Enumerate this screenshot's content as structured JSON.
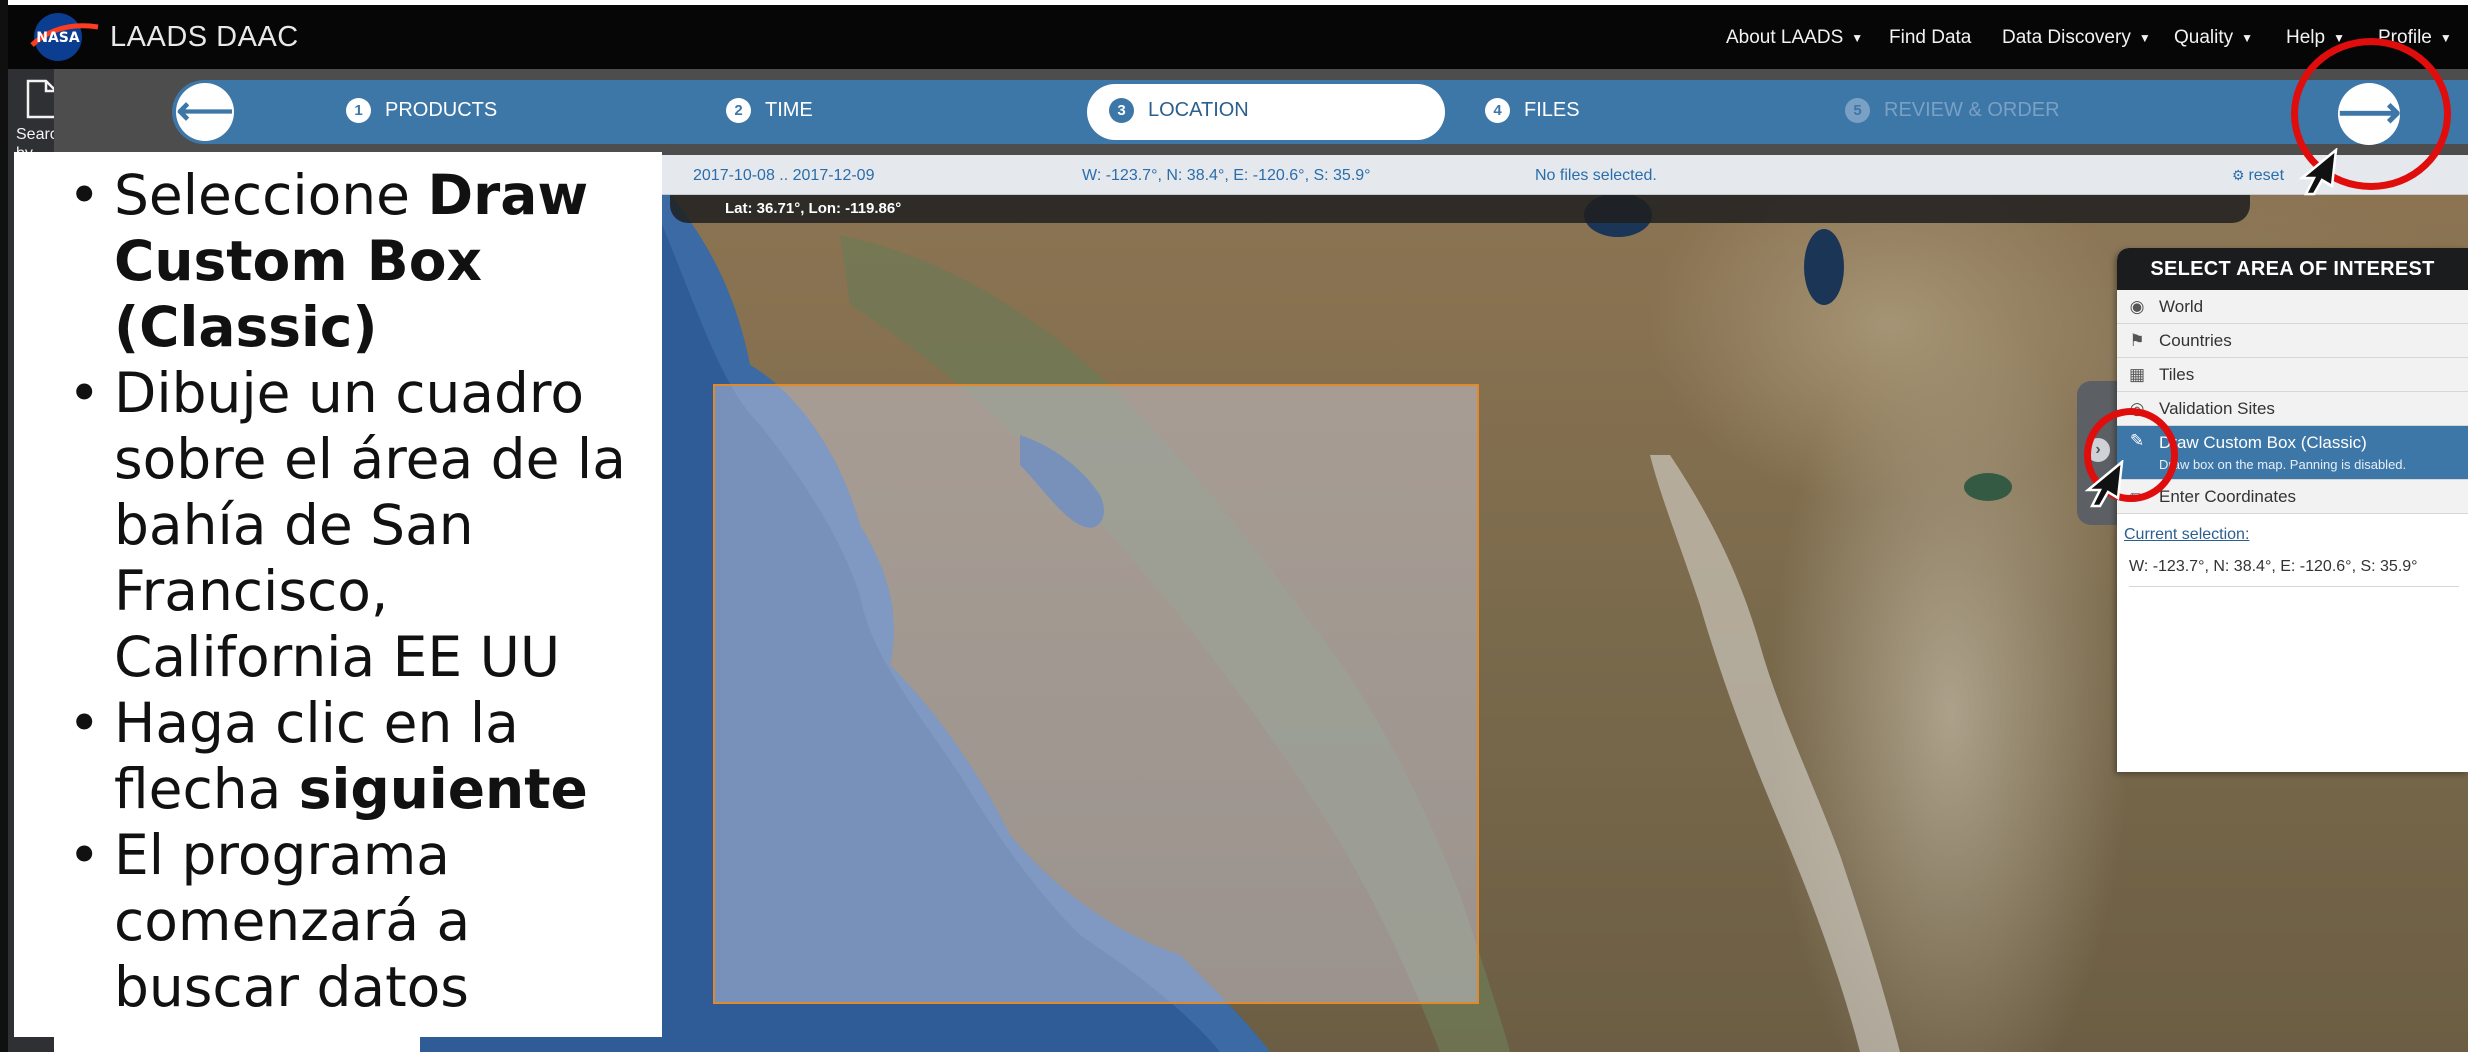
{
  "header": {
    "logo_text": "NASA",
    "app_title": "LAADS DAAC",
    "nav": [
      {
        "label": "About LAADS",
        "dropdown": true
      },
      {
        "label": "Find Data",
        "dropdown": false
      },
      {
        "label": "Data Discovery",
        "dropdown": true
      },
      {
        "label": "Quality",
        "dropdown": true
      },
      {
        "label": "Help",
        "dropdown": true
      },
      {
        "label": "Profile",
        "dropdown": true
      }
    ]
  },
  "sidebar": {
    "search_label": "Search by Product"
  },
  "steps": [
    {
      "number": "1",
      "label": "PRODUCTS",
      "state": "done"
    },
    {
      "number": "2",
      "label": "TIME",
      "state": "done"
    },
    {
      "number": "3",
      "label": "LOCATION",
      "state": "active"
    },
    {
      "number": "4",
      "label": "FILES",
      "state": "pending"
    },
    {
      "number": "5",
      "label": "REVIEW & ORDER",
      "state": "disabled"
    }
  ],
  "info_row": {
    "date_range": "2017-10-08 .. 2017-12-09",
    "bounds": "W: -123.7°, N: 38.4°, E: -120.6°, S: 35.9°",
    "files_status": "No files selected.",
    "reset_label": "reset"
  },
  "map": {
    "cursor_coords": "Lat: 36.71°, Lon: -119.86°"
  },
  "aoi_panel": {
    "title": "SELECT AREA OF INTEREST",
    "items": [
      {
        "label": "World",
        "icon": "globe-icon"
      },
      {
        "label": "Countries",
        "icon": "flag-icon"
      },
      {
        "label": "Tiles",
        "icon": "grid-icon"
      },
      {
        "label": "Validation Sites",
        "icon": "target-icon"
      }
    ],
    "draw_item": {
      "label": "Draw Custom Box (Classic)",
      "hint": "Draw box on the map. Panning is disabled.",
      "icon": "edit-icon"
    },
    "enter_item": {
      "label": "Enter Coordinates",
      "icon": "pencil-icon"
    },
    "current_label": "Current selection:",
    "current_value": "W: -123.7°, N: 38.4°, E: -120.6°, S: 35.9°"
  },
  "tutorial": {
    "bullets": [
      [
        {
          "t": "Seleccione ",
          "b": false
        },
        {
          "t": "Draw Custom Box (Classic)",
          "b": true
        }
      ],
      [
        {
          "t": "Dibuje un cuadro sobre el área de la bahía de San Francisco, California EE UU",
          "b": false
        }
      ],
      [
        {
          "t": "Haga clic en la flecha ",
          "b": false
        },
        {
          "t": "siguiente",
          "b": true
        }
      ],
      [
        {
          "t": "El programa comenzará a buscar datos",
          "b": false
        }
      ]
    ]
  },
  "colors": {
    "step_bar": "#3d77a8",
    "highlight": "#e00d0d",
    "selection_border": "#e08a2a",
    "link": "#2a6dab"
  }
}
